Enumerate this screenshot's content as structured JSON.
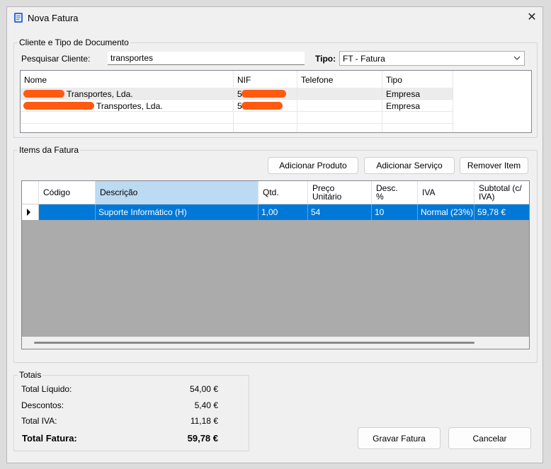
{
  "window": {
    "title": "Nova Fatura",
    "close_glyph": "✕"
  },
  "client_group": {
    "legend": "Cliente e Tipo de Documento",
    "search_label": "Pesquisar Cliente:",
    "search_value": "transportes",
    "type_label": "Tipo:",
    "type_value": "FT - Fatura",
    "columns": [
      "Nome",
      "NIF",
      "Telefone",
      "Tipo"
    ],
    "rows": [
      {
        "name": "Transportes, Lda.",
        "nif": "5",
        "phone": "",
        "type": "Empresa"
      },
      {
        "name": "Transportes, Lda.",
        "nif": "5",
        "phone": "",
        "type": "Empresa"
      }
    ]
  },
  "items_group": {
    "legend": "Items da Fatura",
    "add_product": "Adicionar Produto",
    "add_service": "Adicionar Serviço",
    "remove_item": "Remover Item",
    "columns": [
      "Código",
      "Descrição",
      "Qtd.",
      "Preço\nUnitário",
      "Desc.\n%",
      "IVA",
      "Subtotal (c/\nIVA)"
    ],
    "rows": [
      {
        "code": "",
        "description": "Suporte Informático (H)",
        "qty": "1,00",
        "unit_price": "54",
        "discount": "10",
        "vat": "Normal (23%)",
        "subtotal": "59,78 €"
      }
    ]
  },
  "totals": {
    "legend": "Totais",
    "net_label": "Total Líquido:",
    "net_value": "54,00 €",
    "discounts_label": "Descontos:",
    "discounts_value": "5,40 €",
    "vat_label": "Total IVA:",
    "vat_value": "11,18 €",
    "total_label": "Total Fatura:",
    "total_value": "59,78 €"
  },
  "actions": {
    "save": "Gravar Fatura",
    "cancel": "Cancelar"
  },
  "icons": {
    "app": "invoice-app-icon",
    "close": "close-icon",
    "dropdown": "chevron-down-icon",
    "row_indicator": "row-pointer-icon"
  },
  "colors": {
    "selection": "#0078d7",
    "sorted_header": "#bcdaf2",
    "redaction": "#ff5a10"
  }
}
